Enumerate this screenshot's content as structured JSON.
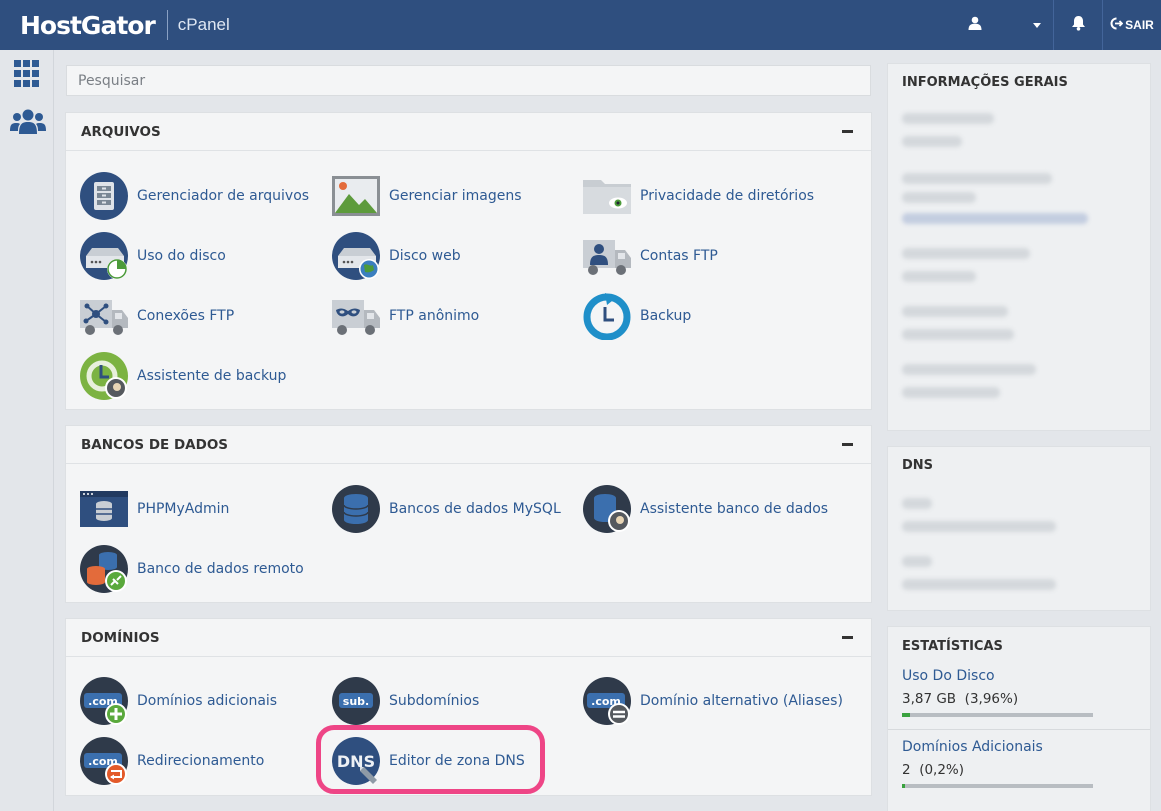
{
  "header": {
    "brand": "HostGator",
    "product": "cPanel",
    "logout_label": "SAIR"
  },
  "search": {
    "placeholder": "Pesquisar"
  },
  "sections": {
    "arquivos": {
      "title": "ARQUIVOS",
      "items": [
        {
          "label": "Gerenciador de arquivos",
          "icon": "file-manager-icon"
        },
        {
          "label": "Gerenciar imagens",
          "icon": "images-icon"
        },
        {
          "label": "Privacidade de diretórios",
          "icon": "directory-privacy-icon"
        },
        {
          "label": "Uso do disco",
          "icon": "disk-usage-icon"
        },
        {
          "label": "Disco web",
          "icon": "web-disk-icon"
        },
        {
          "label": "Contas FTP",
          "icon": "ftp-accounts-icon"
        },
        {
          "label": "Conexões FTP",
          "icon": "ftp-connections-icon"
        },
        {
          "label": "FTP anônimo",
          "icon": "anonymous-ftp-icon"
        },
        {
          "label": "Backup",
          "icon": "backup-icon"
        },
        {
          "label": "Assistente de backup",
          "icon": "backup-wizard-icon"
        }
      ]
    },
    "bancos": {
      "title": "BANCOS DE DADOS",
      "items": [
        {
          "label": "PHPMyAdmin",
          "icon": "phpmyadmin-icon"
        },
        {
          "label": "Bancos de dados MySQL",
          "icon": "mysql-databases-icon"
        },
        {
          "label": "Assistente banco de dados",
          "icon": "database-wizard-icon"
        },
        {
          "label": "Banco de dados remoto",
          "icon": "remote-database-icon"
        }
      ]
    },
    "dominios": {
      "title": "DOMÍNIOS",
      "items": [
        {
          "label": "Domínios adicionais",
          "icon": "addon-domains-icon"
        },
        {
          "label": "Subdomínios",
          "icon": "subdomains-icon"
        },
        {
          "label": "Domínio alternativo (Aliases)",
          "icon": "aliases-icon"
        },
        {
          "label": "Redirecionamento",
          "icon": "redirects-icon"
        },
        {
          "label": "Editor de zona DNS",
          "icon": "dns-zone-editor-icon"
        }
      ]
    }
  },
  "right": {
    "general_title": "INFORMAÇÕES GERAIS",
    "dns_title": "DNS",
    "stats_title": "ESTATÍSTICAS",
    "stats": [
      {
        "label": "Uso Do Disco",
        "value": "3,87 GB",
        "percent": "(3,96%)",
        "fraction": 0.0396
      },
      {
        "label": "Domínios Adicionais",
        "value": "2",
        "percent": "(0,2%)",
        "fraction": 0.002
      }
    ]
  },
  "colors": {
    "topbar": "#2f4f7f",
    "link": "#2e5a93",
    "highlight": "#ee4586",
    "progress": "#3aa23f"
  }
}
